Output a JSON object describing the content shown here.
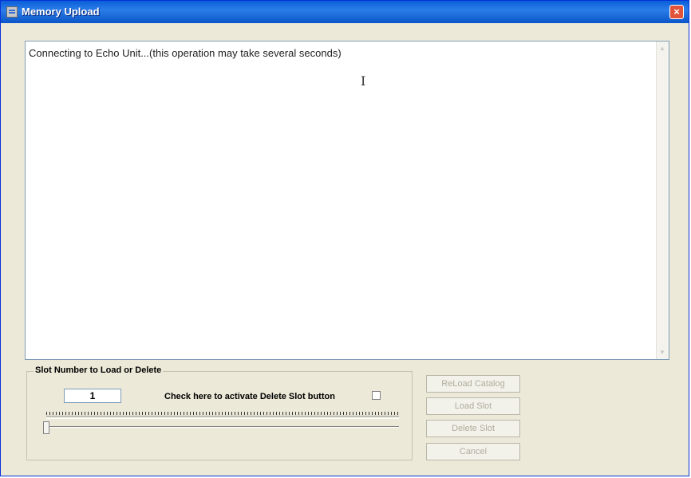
{
  "window": {
    "title": "Memory Upload",
    "close_glyph": "×"
  },
  "log": {
    "text": "Connecting to Echo Unit...(this operation may take several seconds)",
    "cursor_glyph": "I"
  },
  "slot_group": {
    "legend": "Slot Number to Load or Delete",
    "slot_value": "1",
    "check_label": "Check here to activate Delete Slot button",
    "checked": false
  },
  "buttons": {
    "reload": "ReLoad Catalog",
    "load": "Load Slot",
    "delete": "Delete Slot",
    "cancel": "Cancel"
  }
}
